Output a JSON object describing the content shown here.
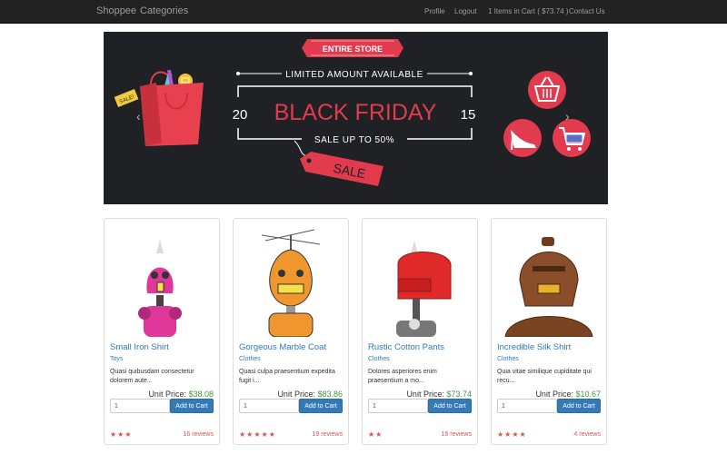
{
  "navbar": {
    "brand": "Shoppee",
    "categories": "Categories",
    "profile": "Profile",
    "logout": "Logout",
    "cart": "1 Items in Cart ( $73.74 )",
    "contact": "Contact Us"
  },
  "banner": {
    "entire_store": "ENTIRE STORE",
    "limited": "LIMITED AMOUNT AVAILABLE",
    "year_left": "20",
    "headline": "BLACK FRIDAY",
    "year_right": "15",
    "sale_up_to": "SALE UP TO 50%",
    "sale_tag": "SALE",
    "small_tag": "SALE!",
    "prev": "‹",
    "next": "›",
    "slides": 3,
    "active_slide": 1
  },
  "products": [
    {
      "title": "Small Iron Shirt",
      "category": "Toys",
      "desc": "Quasi quibusdam consectetur dolorem aute...",
      "price_label": "Unit Price:",
      "price": "$38.08",
      "qty": "1",
      "add_label": "Add to Cart",
      "rating": 3,
      "stars": "★★★",
      "reviews": "16 reviews",
      "robot_color": "#e0389a"
    },
    {
      "title": "Gorgeous Marble Coat",
      "category": "Clothes",
      "desc": "Quasi culpa praesentium expedita fugit i...",
      "price_label": "Unit Price:",
      "price": "$83.86",
      "qty": "1",
      "add_label": "Add to Cart",
      "rating": 5,
      "stars": "★★★★★",
      "reviews": "19 reviews",
      "robot_color": "#f0962e"
    },
    {
      "title": "Rustic Cotton Pants",
      "category": "Clothes",
      "desc": "Dolores asperiores enim praesentium a mo...",
      "price_label": "Unit Price:",
      "price": "$73.74",
      "qty": "1",
      "add_label": "Add to Cart",
      "rating": 2,
      "stars": "★★",
      "reviews": "16 reviews",
      "robot_color": "#e02a2a"
    },
    {
      "title": "Incredible Silk Shirt",
      "category": "Clothes",
      "desc": "Quia vitae similique cupiditate qui recu...",
      "price_label": "Unit Price:",
      "price": "$10.67",
      "qty": "1",
      "add_label": "Add to Cart",
      "rating": 4,
      "stars": "★★★★",
      "reviews": "4 reviews",
      "robot_color": "#8a4f2a"
    }
  ]
}
